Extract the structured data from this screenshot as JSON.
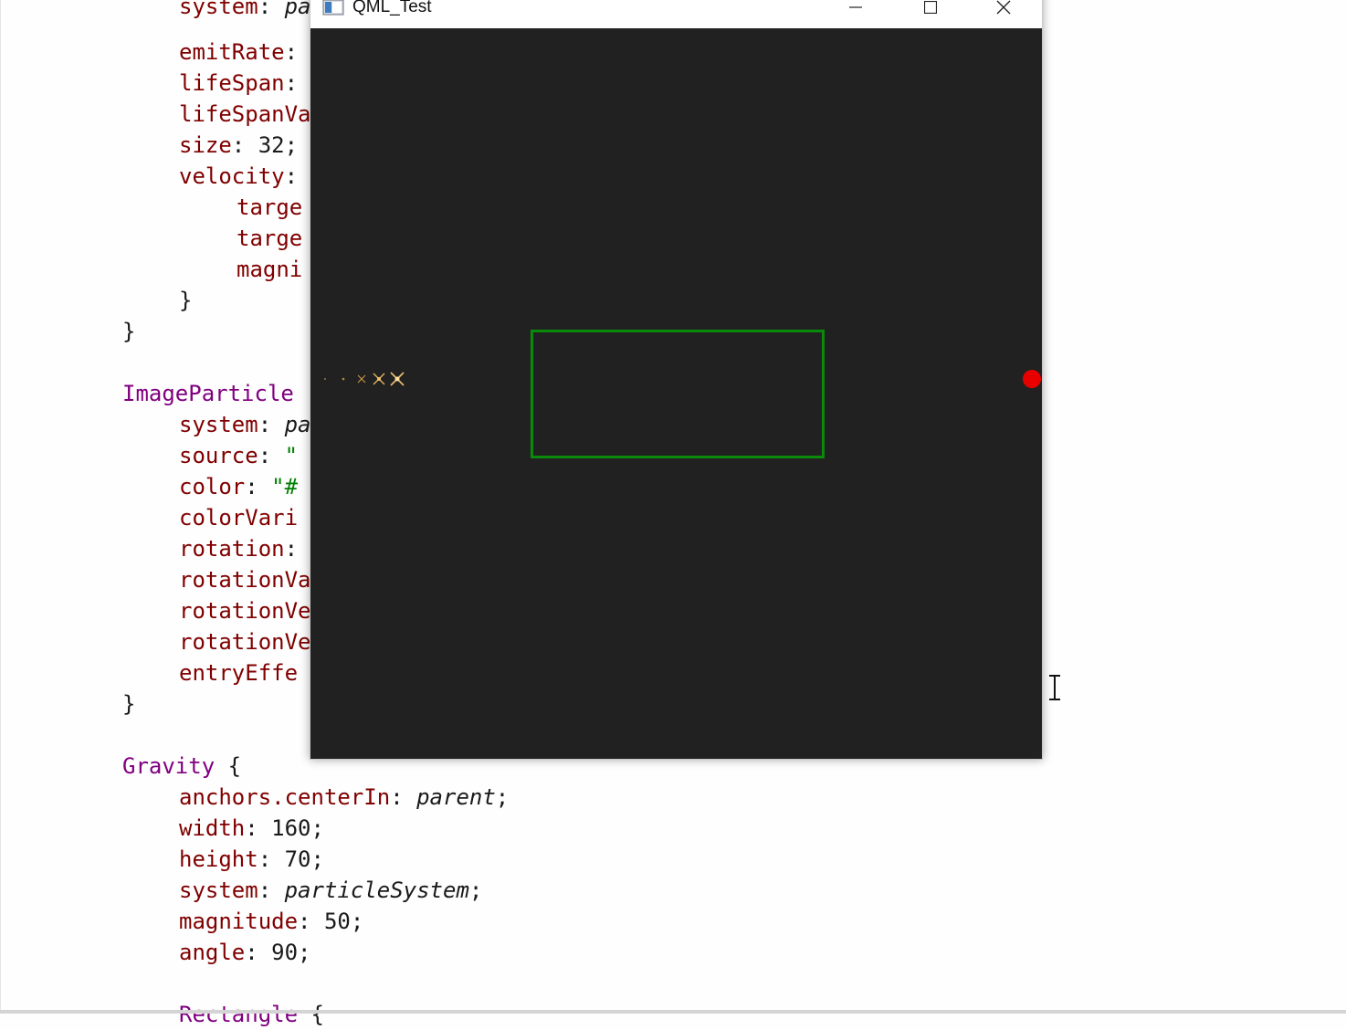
{
  "editor": {
    "lines": {
      "l1": [
        "system",
        ": ",
        "pa"
      ],
      "l2": [
        "emitRate",
        ":"
      ],
      "l3": [
        "lifeSpan",
        ":"
      ],
      "l4": [
        "lifeSpanVa"
      ],
      "l5": [
        "size",
        ": 32;"
      ],
      "l6": [
        "velocity",
        ":"
      ],
      "l7": "targe",
      "l8": "targe",
      "l9": "magni",
      "l10": "}",
      "l11": "}",
      "l12": "ImageParticle",
      "l13": [
        "system",
        ": ",
        "pa"
      ],
      "l14": [
        "source",
        ": ",
        "\""
      ],
      "l15": [
        "color",
        ": ",
        "\"#"
      ],
      "l16": "colorVari",
      "l17": [
        "rotation",
        ":"
      ],
      "l18": "rotationVa",
      "l19": "rotationVe",
      "l20": "rotationVe",
      "l21": "entryEffe",
      "l22": "}",
      "l23": [
        "Gravity",
        " {"
      ],
      "l24": [
        "anchors.centerIn",
        ": ",
        "parent",
        ";"
      ],
      "l25": [
        "width",
        ": 160;"
      ],
      "l26": [
        "height",
        ": 70;"
      ],
      "l27": [
        "system",
        ": ",
        "particleSystem",
        ";"
      ],
      "l28": [
        "magnitude",
        ": 50;"
      ],
      "l29": [
        "angle",
        ": 90;"
      ],
      "l30": [
        "Rectangle",
        " {"
      ]
    }
  },
  "window": {
    "title": "QML_Test",
    "icon": "app-window-icon",
    "buttons": {
      "minimize": "minimize-icon",
      "maximize": "maximize-icon",
      "close": "close-icon"
    },
    "canvas_background": "#212121",
    "gravity_rect_color": "#0a8a0a",
    "emitter_dot_color": "#e80000"
  },
  "colors": {
    "type_keyword": "#800080",
    "property": "#800000"
  }
}
